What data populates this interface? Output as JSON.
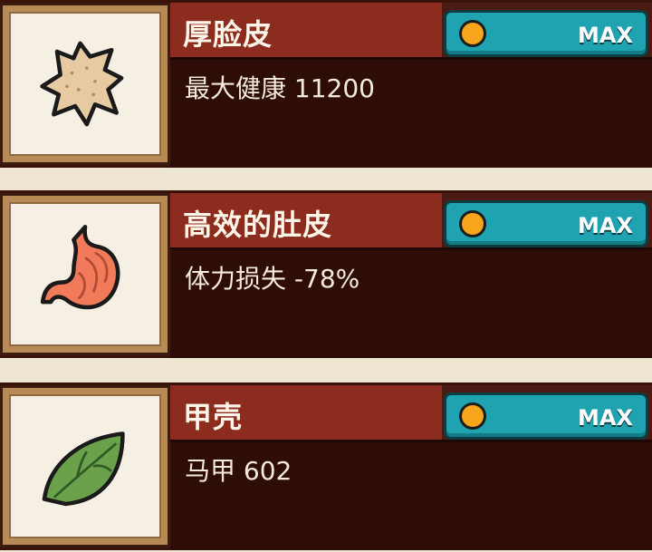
{
  "items": [
    {
      "title": "厚脸皮",
      "stat": "最大健康 11200",
      "button_label": "MAX",
      "icon": "skin-hide-icon",
      "icon_color": "#e7c9a2"
    },
    {
      "title": "高效的肚皮",
      "stat": "体力损失 -78%",
      "button_label": "MAX",
      "icon": "stomach-icon",
      "icon_color": "#f07a5a"
    },
    {
      "title": "甲壳",
      "stat": "马甲 602",
      "button_label": "MAX",
      "icon": "leaf-shell-icon",
      "icon_color": "#6aa14a"
    }
  ],
  "colors": {
    "title_bar": "#8b2c1e",
    "button": "#1fa3b0",
    "coin": "#f7a51c",
    "panel": "#2e0c07"
  }
}
